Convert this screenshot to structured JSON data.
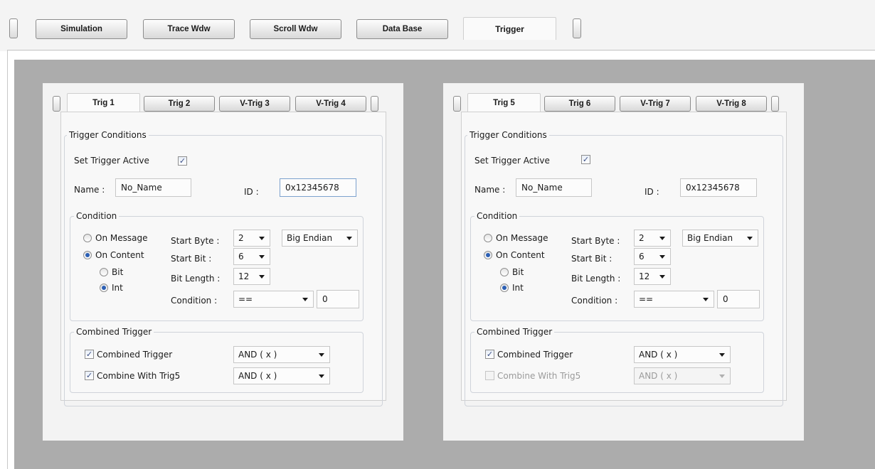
{
  "top_tabs": [
    "Simulation",
    "Trace Wdw",
    "Scroll Wdw",
    "Data Base",
    "Trigger"
  ],
  "panels": [
    {
      "tabs": [
        "Trig 1",
        "Trig 2",
        "V-Trig 3",
        "V-Trig 4"
      ],
      "trigger_conditions_label": "Trigger Conditions",
      "set_active_label": "Set Trigger Active",
      "name_label": "Name :",
      "name_value": "No_Name",
      "id_label": "ID :",
      "id_value": "0x12345678",
      "condition_label": "Condition",
      "on_message_label": "On Message",
      "on_content_label": "On Content",
      "bit_label": "Bit",
      "int_label": "Int",
      "start_byte_label": "Start Byte :",
      "start_byte_value": "2",
      "endian_value": "Big Endian",
      "start_bit_label": "Start Bit :",
      "start_bit_value": "6",
      "bit_length_label": "Bit Length :",
      "bit_length_value": "12",
      "condition_op_label": "Condition :",
      "condition_op_value": "==",
      "condition_value": "0",
      "combined_group_label": "Combined Trigger",
      "combined_check_label": "Combined Trigger",
      "combined_select_value": "AND ( x )",
      "combine_with_label": "Combine With Trig5",
      "combine_with_value": "AND ( x )"
    },
    {
      "tabs": [
        "Trig 5",
        "Trig 6",
        "V-Trig 7",
        "V-Trig 8"
      ],
      "trigger_conditions_label": "Trigger Conditions",
      "set_active_label": "Set Trigger Active",
      "name_label": "Name :",
      "name_value": "No_Name",
      "id_label": "ID :",
      "id_value": "0x12345678",
      "condition_label": "Condition",
      "on_message_label": "On Message",
      "on_content_label": "On Content",
      "bit_label": "Bit",
      "int_label": "Int",
      "start_byte_label": "Start Byte :",
      "start_byte_value": "2",
      "endian_value": "Big Endian",
      "start_bit_label": "Start Bit :",
      "start_bit_value": "6",
      "bit_length_label": "Bit Length :",
      "bit_length_value": "12",
      "condition_op_label": "Condition :",
      "condition_op_value": "==",
      "condition_value": "0",
      "combined_group_label": "Combined Trigger",
      "combined_check_label": "Combined Trigger",
      "combined_select_value": "AND ( x )",
      "combine_with_label": "Combine With Trig5",
      "combine_with_value": "AND ( x )"
    }
  ],
  "check_glyph": "✓"
}
